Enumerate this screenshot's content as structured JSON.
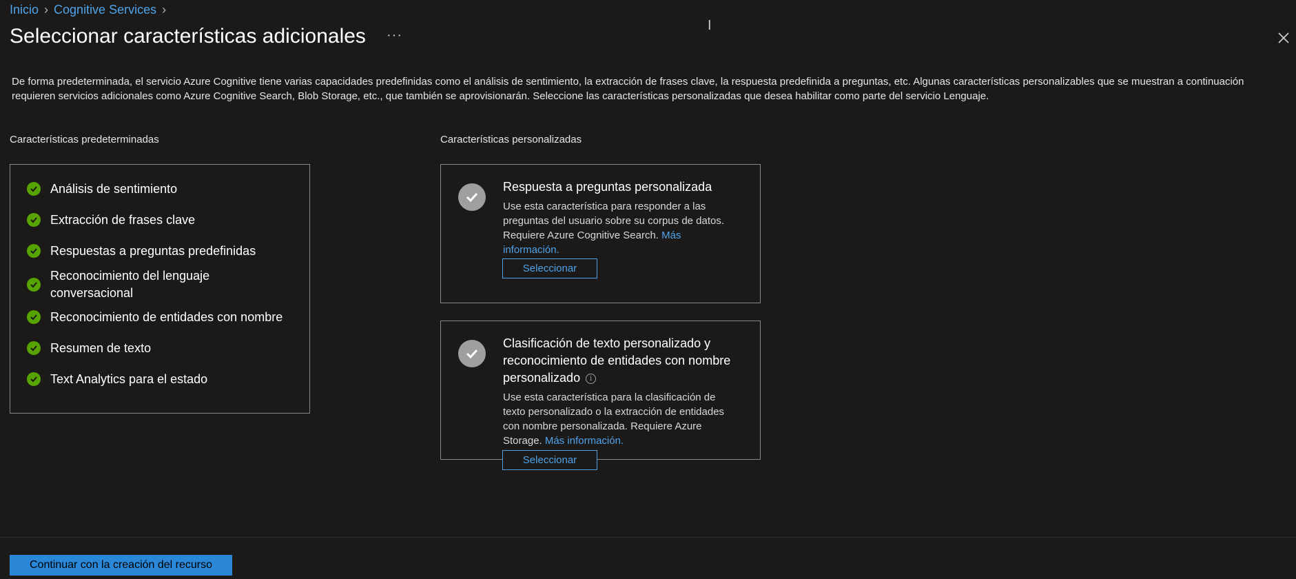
{
  "breadcrumb": {
    "items": [
      "Inicio",
      "Cognitive Services"
    ]
  },
  "title": "Seleccionar características adicionales",
  "more_label": "···",
  "description": "De forma predeterminada, el servicio Azure Cognitive tiene varias capacidades predefinidas como el análisis de sentimiento, la extracción de frases clave, la respuesta predefinida a preguntas, etc. Algunas características personalizables que se muestran a continuación requieren servicios adicionales como Azure Cognitive Search, Blob Storage, etc., que también se aprovisionarán. Seleccione las características personalizadas que desea habilitar como parte del servicio Lenguaje.",
  "default_section": {
    "label": "Características predeterminadas",
    "features": [
      "Análisis de sentimiento",
      "Extracción de frases clave",
      "Respuestas a preguntas predefinidas",
      "Reconocimiento del lenguaje conversacional",
      "Reconocimiento de entidades con nombre",
      "Resumen de texto",
      "Text Analytics para el estado"
    ]
  },
  "custom_section": {
    "label": "Características personalizadas",
    "cards": [
      {
        "title": "Respuesta a preguntas personalizada",
        "description": "Use esta característica para responder a las preguntas del usuario sobre su corpus de datos. Requiere Azure Cognitive Search.",
        "link": "Más información.",
        "button": "Seleccionar"
      },
      {
        "title": "Clasificación de texto personalizado y reconocimiento de entidades con nombre personalizado",
        "description": "Use esta característica para la clasificación de texto personalizado o la extracción de entidades con nombre personalizada. Requiere Azure Storage.",
        "link": "Más información.",
        "button": "Seleccionar"
      }
    ]
  },
  "footer": {
    "primary_button": "Continuar con la creación del recurso"
  },
  "colors": {
    "background": "#1b1a19",
    "accent": "#2b88d8",
    "link": "#4fa3ea",
    "success": "#57a300"
  }
}
